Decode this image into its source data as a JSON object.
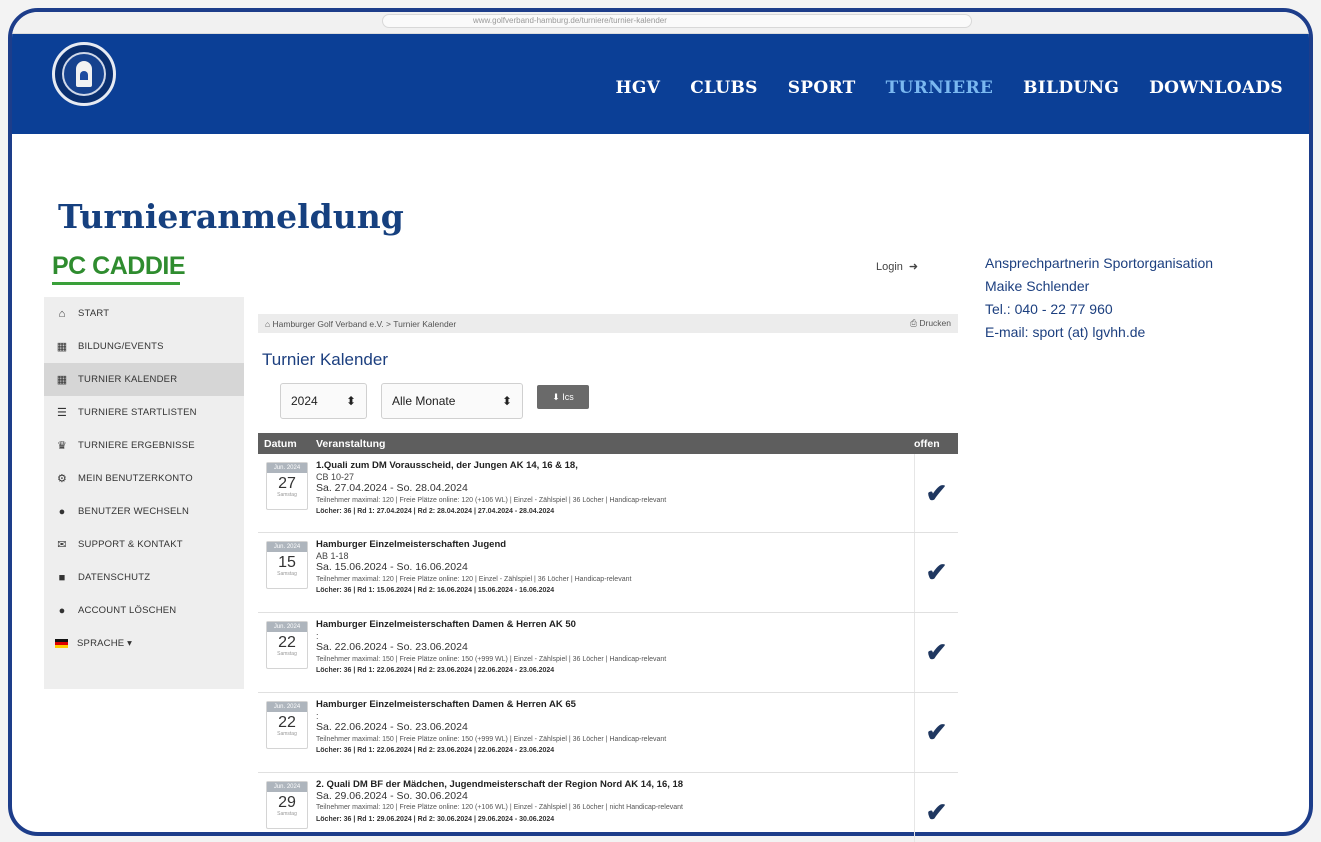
{
  "browser": {
    "url": "www.golfverband-hamburg.de/turniere/turnier-kalender"
  },
  "header": {
    "logo_icon": "club-crest-logo",
    "nav": [
      {
        "label": "HGV",
        "active": false
      },
      {
        "label": "CLUBS",
        "active": false
      },
      {
        "label": "SPORT",
        "active": false
      },
      {
        "label": "TURNIERE",
        "active": true
      },
      {
        "label": "BILDUNG",
        "active": false
      },
      {
        "label": "DOWNLOADS",
        "active": false
      }
    ]
  },
  "page_title": "Turnieranmeldung",
  "pccaddie": {
    "brand": "PC CADDIE"
  },
  "login": {
    "label": "Login",
    "icon": "sign-in-icon"
  },
  "contact": {
    "heading": "Ansprechpartnerin Sportorganisation",
    "name": "Maike Schlender",
    "phone": "Tel.: 040 - 22 77 960",
    "email": "E-mail: sport (at) lgvhh.de"
  },
  "sidebar": {
    "items": [
      {
        "label": "START",
        "icon": "home-icon"
      },
      {
        "label": "BILDUNG/EVENTS",
        "icon": "calendar-icon"
      },
      {
        "label": "TURNIER KALENDER",
        "icon": "calendar-icon",
        "active": true
      },
      {
        "label": "TURNIERE STARTLISTEN",
        "icon": "list-icon"
      },
      {
        "label": "TURNIERE ERGEBNISSE",
        "icon": "trophy-icon"
      },
      {
        "label": "MEIN BENUTZERKONTO",
        "icon": "cogs-icon"
      },
      {
        "label": "BENUTZER WECHSELN",
        "icon": "user-icon"
      },
      {
        "label": "SUPPORT & KONTAKT",
        "icon": "envelope-icon"
      },
      {
        "label": "DATENSCHUTZ",
        "icon": "document-icon"
      },
      {
        "label": "ACCOUNT LÖSCHEN",
        "icon": "user-icon"
      },
      {
        "label": "SPRACHE ▾",
        "icon": "german-flag-icon"
      }
    ]
  },
  "breadcrumb": {
    "text": "Hamburger Golf Verband e.V. > Turnier Kalender",
    "print_label": "Drucken"
  },
  "calendar": {
    "title": "Turnier Kalender",
    "year_select": "2024",
    "month_select": "Alle Monate",
    "ics_label": "Ics",
    "columns": {
      "date": "Datum",
      "event": "Veranstaltung",
      "open": "offen"
    },
    "rows": [
      {
        "month": "Jun. 2024",
        "day": "27",
        "weekday": "Samstag",
        "name": "1.Quali zum DM Vorausscheid, der Jungen AK 14, 16 & 18,",
        "sub": "CB 10-27",
        "dates": "Sa. 27.04.2024 - So. 28.04.2024",
        "info": "Teilnehmer maximal: 120 | Freie Plätze online: 120 (+106 WL) | Einzel - Zählspiel | 36 Löcher | Handicap-relevant",
        "holes": "Löcher: 36 | Rd 1: 27.04.2024 | Rd 2: 28.04.2024 | 27.04.2024 - 28.04.2024",
        "open": "✔"
      },
      {
        "month": "Jun. 2024",
        "day": "15",
        "weekday": "Samstag",
        "name": "Hamburger Einzelmeisterschaften Jugend",
        "sub": "AB 1-18",
        "dates": "Sa. 15.06.2024 - So. 16.06.2024",
        "info": "Teilnehmer maximal: 120 | Freie Plätze online: 120 | Einzel - Zählspiel | 36 Löcher | Handicap-relevant",
        "holes": "Löcher: 36 | Rd 1: 15.06.2024 | Rd 2: 16.06.2024 | 15.06.2024 - 16.06.2024",
        "open": "✔"
      },
      {
        "month": "Jun. 2024",
        "day": "22",
        "weekday": "Samstag",
        "name": "Hamburger Einzelmeisterschaften Damen & Herren AK 50",
        "sub": ":",
        "dates": "Sa. 22.06.2024 - So. 23.06.2024",
        "info": "Teilnehmer maximal: 150 | Freie Plätze online: 150 (+999 WL) | Einzel - Zählspiel | 36 Löcher | Handicap-relevant",
        "holes": "Löcher: 36 | Rd 1: 22.06.2024 | Rd 2: 23.06.2024 | 22.06.2024 - 23.06.2024",
        "open": "✔"
      },
      {
        "month": "Jun. 2024",
        "day": "22",
        "weekday": "Samstag",
        "name": "Hamburger Einzelmeisterschaften Damen & Herren AK 65",
        "sub": ":",
        "dates": "Sa. 22.06.2024 - So. 23.06.2024",
        "info": "Teilnehmer maximal: 150 | Freie Plätze online: 150 (+999 WL) | Einzel - Zählspiel | 36 Löcher | Handicap-relevant",
        "holes": "Löcher: 36 | Rd 1: 22.06.2024 | Rd 2: 23.06.2024 | 22.06.2024 - 23.06.2024",
        "open": "✔"
      },
      {
        "month": "Jun. 2024",
        "day": "29",
        "weekday": "Samstag",
        "name": "2. Quali DM BF der Mädchen, Jugendmeisterschaft der Region Nord AK 14, 16, 18",
        "sub": "",
        "dates": "Sa. 29.06.2024 - So. 30.06.2024",
        "info": "Teilnehmer maximal: 120 | Freie Plätze online: 120 (+106 WL) | Einzel - Zählspiel | 36 Löcher | nicht Handicap-relevant",
        "holes": "Löcher: 36 | Rd 1: 29.06.2024 | Rd 2: 30.06.2024 | 29.06.2024 - 30.06.2024",
        "open": "✔"
      }
    ]
  }
}
